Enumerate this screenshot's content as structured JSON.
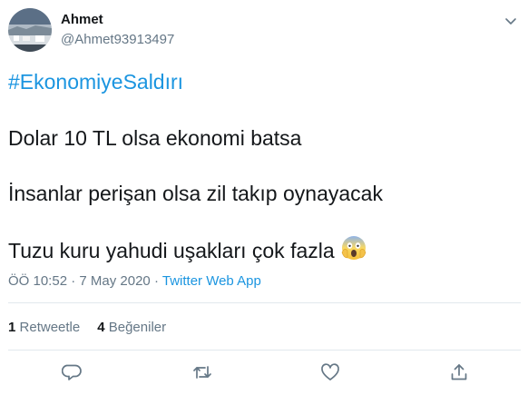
{
  "tweet": {
    "author": {
      "name": "Ahmet",
      "handle": "@Ahmet93913497"
    },
    "hashtag": "#EkonomiyeSaldırı",
    "lines": [
      "Dolar 10 TL olsa ekonomi batsa",
      "İnsanlar perişan olsa zil takıp oynayacak",
      "Tuzu kuru yahudi uşakları çok fazla"
    ],
    "emoji": "face-screaming-in-fear",
    "time": "ÖÖ 10:52",
    "separator": "·",
    "date": "7 May 2020",
    "source": "Twitter Web App",
    "stats": {
      "retweets_count": "1",
      "retweets_label": "Retweetle",
      "likes_count": "4",
      "likes_label": "Beğeniler"
    },
    "actions": [
      "reply-icon",
      "retweet-icon",
      "like-icon",
      "share-icon"
    ],
    "colors": {
      "link": "#1b95e0",
      "text": "#14171a",
      "muted": "#657786",
      "divider": "#e1e8ed"
    }
  }
}
